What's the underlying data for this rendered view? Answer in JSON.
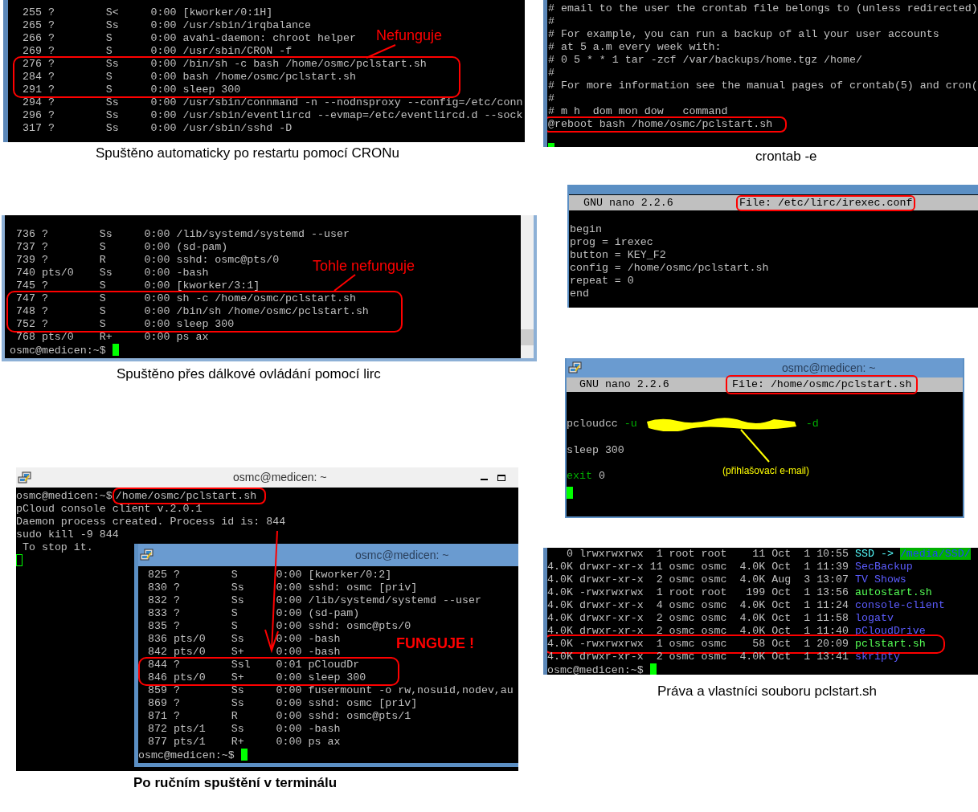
{
  "cron_ps": {
    "rows": [
      {
        "pid": "255",
        "tty": "?",
        "stat": "S<",
        "time": "0:00",
        "command": "[kworker/0:1H]",
        "highlighted": false
      },
      {
        "pid": "265",
        "tty": "?",
        "stat": "Ss",
        "time": "0:00",
        "command": "/usr/sbin/irqbalance",
        "highlighted": false
      },
      {
        "pid": "266",
        "tty": "?",
        "stat": "S",
        "time": "0:00",
        "command": "avahi-daemon: chroot helper",
        "highlighted": false
      },
      {
        "pid": "269",
        "tty": "?",
        "stat": "S",
        "time": "0:00",
        "command": "/usr/sbin/CRON -f",
        "highlighted": false
      },
      {
        "pid": "276",
        "tty": "?",
        "stat": "Ss",
        "time": "0:00",
        "command": "/bin/sh -c bash /home/osmc/pclstart.sh",
        "highlighted": true
      },
      {
        "pid": "284",
        "tty": "?",
        "stat": "S",
        "time": "0:00",
        "command": "bash /home/osmc/pclstart.sh",
        "highlighted": true
      },
      {
        "pid": "291",
        "tty": "?",
        "stat": "S",
        "time": "0:00",
        "command": "sleep 300",
        "highlighted": true
      },
      {
        "pid": "294",
        "tty": "?",
        "stat": "Ss",
        "time": "0:00",
        "command": "/usr/sbin/connmand -n --nodnsproxy --config=/etc/conn",
        "highlighted": false
      },
      {
        "pid": "296",
        "tty": "?",
        "stat": "Ss",
        "time": "0:00",
        "command": "/usr/sbin/eventlircd --evmap=/etc/eventlircd.d --sock",
        "highlighted": false
      },
      {
        "pid": "317",
        "tty": "?",
        "stat": "Ss",
        "time": "0:00",
        "command": "/usr/sbin/sshd -D",
        "highlighted": false
      }
    ],
    "annotation": "Nefunguje",
    "caption": "Spuštěno automaticky po restartu pomocí CRONu"
  },
  "crontab": {
    "lines": [
      {
        "text": "# email to the user the crontab file belongs to (unless redirected)",
        "highlighted": false
      },
      {
        "text": "#",
        "highlighted": false
      },
      {
        "text": "# For example, you can run a backup of all your user accounts",
        "highlighted": false
      },
      {
        "text": "# at 5 a.m every week with:",
        "highlighted": false
      },
      {
        "text": "# 0 5 * * 1 tar -zcf /var/backups/home.tgz /home/",
        "highlighted": false
      },
      {
        "text": "#",
        "highlighted": false
      },
      {
        "text": "# For more information see the manual pages of crontab(5) and cron(",
        "highlighted": false
      },
      {
        "text": "#",
        "highlighted": false
      },
      {
        "text": "# m h  dom mon dow   command",
        "highlighted": false
      },
      {
        "text": "@reboot bash /home/osmc/pclstart.sh",
        "highlighted": true
      }
    ],
    "caption": "crontab -e"
  },
  "lirc_ps": {
    "rows": [
      {
        "pid": "736",
        "tty": "?",
        "stat": "Ss",
        "time": "0:00",
        "command": "/lib/systemd/systemd --user",
        "highlighted": false
      },
      {
        "pid": "737",
        "tty": "?",
        "stat": "S",
        "time": "0:00",
        "command": "(sd-pam)",
        "highlighted": false
      },
      {
        "pid": "739",
        "tty": "?",
        "stat": "R",
        "time": "0:00",
        "command": "sshd: osmc@pts/0",
        "highlighted": false
      },
      {
        "pid": "740",
        "tty": "pts/0",
        "stat": "Ss",
        "time": "0:00",
        "command": "-bash",
        "highlighted": false
      },
      {
        "pid": "745",
        "tty": "?",
        "stat": "S",
        "time": "0:00",
        "command": "[kworker/3:1]",
        "highlighted": false
      },
      {
        "pid": "747",
        "tty": "?",
        "stat": "S",
        "time": "0:00",
        "command": "sh -c /home/osmc/pclstart.sh",
        "highlighted": true
      },
      {
        "pid": "748",
        "tty": "?",
        "stat": "S",
        "time": "0:00",
        "command": "/bin/sh /home/osmc/pclstart.sh",
        "highlighted": true
      },
      {
        "pid": "752",
        "tty": "?",
        "stat": "S",
        "time": "0:00",
        "command": "sleep 300",
        "highlighted": true
      },
      {
        "pid": "768",
        "tty": "pts/0",
        "stat": "R+",
        "time": "0:00",
        "command": "ps ax",
        "highlighted": false
      }
    ],
    "prompt": "osmc@medicen:~$",
    "annotation": "Tohle nefunguje",
    "caption": "Spuštěno přes dálkové ovládání pomocí lirc"
  },
  "irexec_nano": {
    "app": "GNU nano 2.2.6",
    "file": "File: /etc/lirc/irexec.conf",
    "lines": [
      "begin",
      "prog = irexec",
      "button = KEY_F2",
      "config = /home/osmc/pclstart.sh",
      "repeat = 0",
      "end"
    ]
  },
  "pclstart_nano": {
    "title": "osmc@medicen: ~",
    "app": "GNU nano 2.2.6",
    "file": "File: /home/osmc/pclstart.sh",
    "lines": [
      [
        {
          "kind": "text",
          "text": "pcloudcc ",
          "color": "#c0c0c0"
        },
        {
          "kind": "text",
          "text": "-u",
          "color": "#00b000"
        },
        {
          "kind": "redaction"
        },
        {
          "kind": "text",
          "text": "-d",
          "color": "#00b000"
        }
      ],
      [
        {
          "kind": "text",
          "text": "sleep 300",
          "color": "#c0c0c0"
        }
      ],
      [
        {
          "kind": "text",
          "text": "exit",
          "color": "#00b000"
        },
        {
          "kind": "text",
          "text": " 0",
          "color": "#c0c0c0"
        }
      ]
    ],
    "annotation": "(přihlašovací e-mail)"
  },
  "manual_terminal": {
    "title": "osmc@medicen: ~",
    "prompt": "osmc@medicen:~$",
    "command": "/home/osmc/pclstart.sh",
    "output": [
      "pCloud console client v.2.0.1",
      "Daemon process created. Process id is: 844",
      "sudo kill -9 844",
      " To stop it."
    ],
    "cursor_focused": false,
    "inner_window": {
      "title": "osmc@medicen: ~",
      "rows": [
        {
          "pid": "825",
          "tty": "?",
          "stat": "S",
          "time": "0:00",
          "command": "[kworker/0:2]",
          "highlighted": false
        },
        {
          "pid": "830",
          "tty": "?",
          "stat": "Ss",
          "time": "0:00",
          "command": "sshd: osmc [priv]",
          "highlighted": false
        },
        {
          "pid": "832",
          "tty": "?",
          "stat": "Ss",
          "time": "0:00",
          "command": "/lib/systemd/systemd --user",
          "highlighted": false
        },
        {
          "pid": "833",
          "tty": "?",
          "stat": "S",
          "time": "0:00",
          "command": "(sd-pam)",
          "highlighted": false
        },
        {
          "pid": "835",
          "tty": "?",
          "stat": "S",
          "time": "0:00",
          "command": "sshd: osmc@pts/0",
          "highlighted": false
        },
        {
          "pid": "836",
          "tty": "pts/0",
          "stat": "Ss",
          "time": "0:00",
          "command": "-bash",
          "highlighted": false
        },
        {
          "pid": "842",
          "tty": "pts/0",
          "stat": "S+",
          "time": "0:00",
          "command": "-bash",
          "highlighted": false
        },
        {
          "pid": "844",
          "tty": "?",
          "stat": "Ssl",
          "time": "0:01",
          "command": "pCloudDr",
          "highlighted": true
        },
        {
          "pid": "846",
          "tty": "pts/0",
          "stat": "S+",
          "time": "0:00",
          "command": "sleep 300",
          "highlighted": true
        },
        {
          "pid": "859",
          "tty": "?",
          "stat": "Ss",
          "time": "0:00",
          "command": "fusermount -o rw,nosuid,nodev,au",
          "highlighted": false
        },
        {
          "pid": "869",
          "tty": "?",
          "stat": "Ss",
          "time": "0:00",
          "command": "sshd: osmc [priv]",
          "highlighted": false
        },
        {
          "pid": "871",
          "tty": "?",
          "stat": "R",
          "time": "0:00",
          "command": "sshd: osmc@pts/1",
          "highlighted": false
        },
        {
          "pid": "872",
          "tty": "pts/1",
          "stat": "Ss",
          "time": "0:00",
          "command": "-bash",
          "highlighted": false
        },
        {
          "pid": "877",
          "tty": "pts/1",
          "stat": "R+",
          "time": "0:00",
          "command": "ps ax",
          "highlighted": false
        }
      ],
      "prompt": "osmc@medicen:~$"
    },
    "annotation": "FUNGUJE !",
    "caption": "Po ručním spuštění v terminálu"
  },
  "listing": {
    "rows": [
      {
        "size": "0",
        "perms": "lrwxrwxrwx",
        "links": "1",
        "owner": "root",
        "group": "root",
        "bytes": "11",
        "month": "Oct",
        "day": "1",
        "time": "10:55",
        "name": "SSD ->",
        "color": "#55ffff",
        "target": "/media/SSD/",
        "highlighted": false
      },
      {
        "size": "4.0K",
        "perms": "drwxr-xr-x",
        "links": "11",
        "owner": "osmc",
        "group": "osmc",
        "bytes": "4.0K",
        "month": "Oct",
        "day": "1",
        "time": "11:39",
        "name": "SecBackup",
        "color": "#5c5cff",
        "highlighted": false
      },
      {
        "size": "4.0K",
        "perms": "drwxr-xr-x",
        "links": "2",
        "owner": "osmc",
        "group": "osmc",
        "bytes": "4.0K",
        "month": "Aug",
        "day": "3",
        "time": "13:07",
        "name": "TV Shows",
        "color": "#5c5cff",
        "highlighted": false
      },
      {
        "size": "4.0K",
        "perms": "-rwxrwxrwx",
        "links": "1",
        "owner": "root",
        "group": "root",
        "bytes": "199",
        "month": "Oct",
        "day": "1",
        "time": "13:56",
        "name": "autostart.sh",
        "color": "#55ff55",
        "highlighted": false
      },
      {
        "size": "4.0K",
        "perms": "drwxr-xr-x",
        "links": "4",
        "owner": "osmc",
        "group": "osmc",
        "bytes": "4.0K",
        "month": "Oct",
        "day": "1",
        "time": "11:24",
        "name": "console-client",
        "color": "#5c5cff",
        "highlighted": false
      },
      {
        "size": "4.0K",
        "perms": "drwxr-xr-x",
        "links": "2",
        "owner": "osmc",
        "group": "osmc",
        "bytes": "4.0K",
        "month": "Oct",
        "day": "1",
        "time": "11:58",
        "name": "logatv",
        "color": "#5c5cff",
        "highlighted": false
      },
      {
        "size": "4.0K",
        "perms": "drwxr-xr-x",
        "links": "2",
        "owner": "osmc",
        "group": "osmc",
        "bytes": "4.0K",
        "month": "Oct",
        "day": "1",
        "time": "11:40",
        "name": "pCloudDrive",
        "color": "#5c5cff",
        "highlighted": false
      },
      {
        "size": "4.0K",
        "perms": "-rwxrwxrwx",
        "links": "1",
        "owner": "osmc",
        "group": "osmc",
        "bytes": "58",
        "month": "Oct",
        "day": "1",
        "time": "20:09",
        "name": "pclstart.sh",
        "color": "#55ff55",
        "highlighted": true
      },
      {
        "size": "4.0K",
        "perms": "drwxr-xr-x",
        "links": "2",
        "owner": "osmc",
        "group": "osmc",
        "bytes": "4.0K",
        "month": "Oct",
        "day": "1",
        "time": "13:41",
        "name": "skripty",
        "color": "#5c5cff",
        "highlighted": false
      }
    ],
    "prompt": "osmc@medicen:~$",
    "caption": "Práva a vlastníci souboru pclstart.sh"
  }
}
